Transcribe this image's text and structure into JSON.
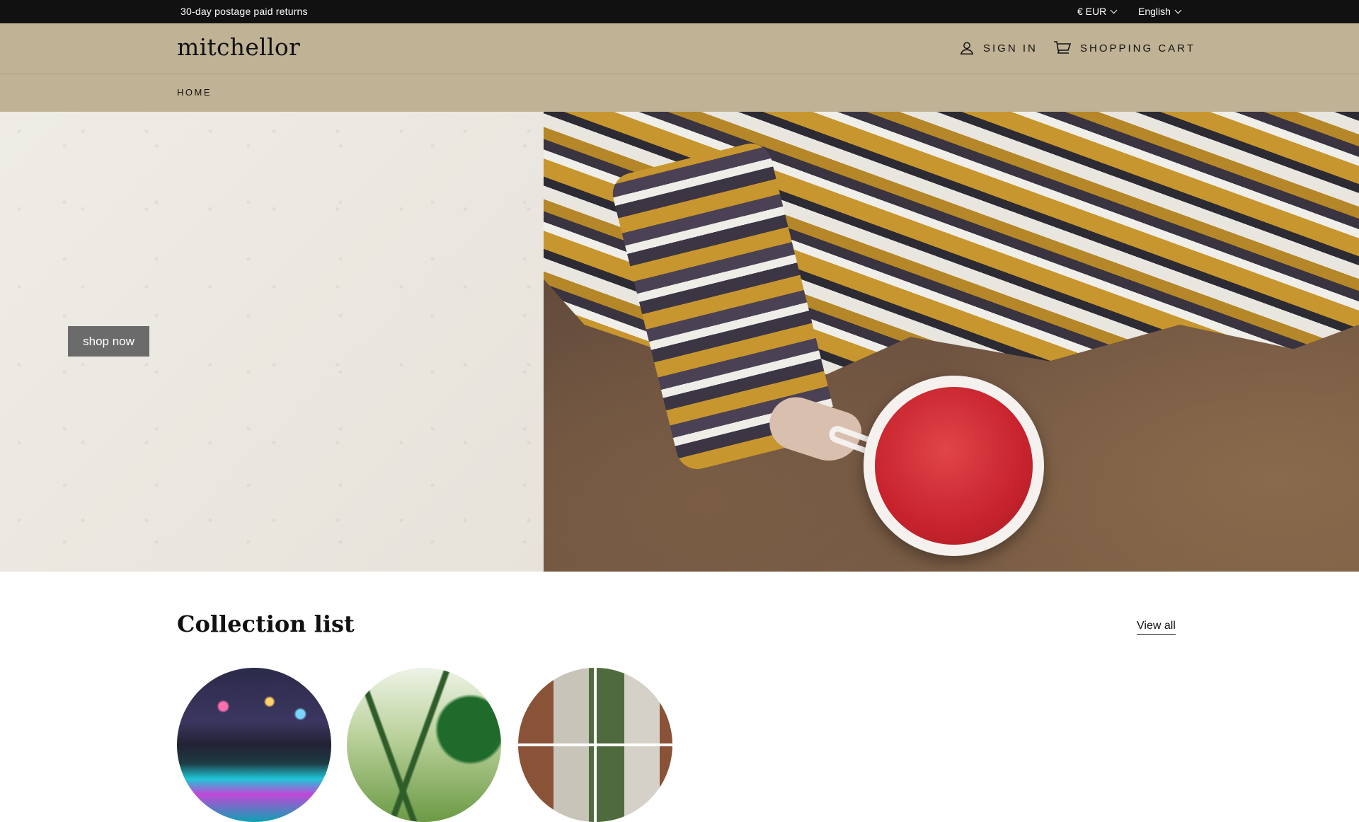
{
  "announcement": {
    "message": "30-day postage paid returns",
    "currency": "€ EUR",
    "language": "English"
  },
  "header": {
    "logo": "mitchellor",
    "sign_in": "SIGN IN",
    "cart": "SHOPPING CART"
  },
  "nav": {
    "items": [
      {
        "label": "HOME"
      }
    ]
  },
  "hero": {
    "button_label": "shop now"
  },
  "collection": {
    "title": "Collection list",
    "view_all": "View all",
    "items": [
      {
        "icon": "led-solar-lights"
      },
      {
        "icon": "garden-trellis"
      },
      {
        "icon": "interior-collage"
      }
    ]
  },
  "colors": {
    "announcement_bg": "#111111",
    "header_bg": "#c0b295",
    "button_bg": "#6b6b6b"
  }
}
